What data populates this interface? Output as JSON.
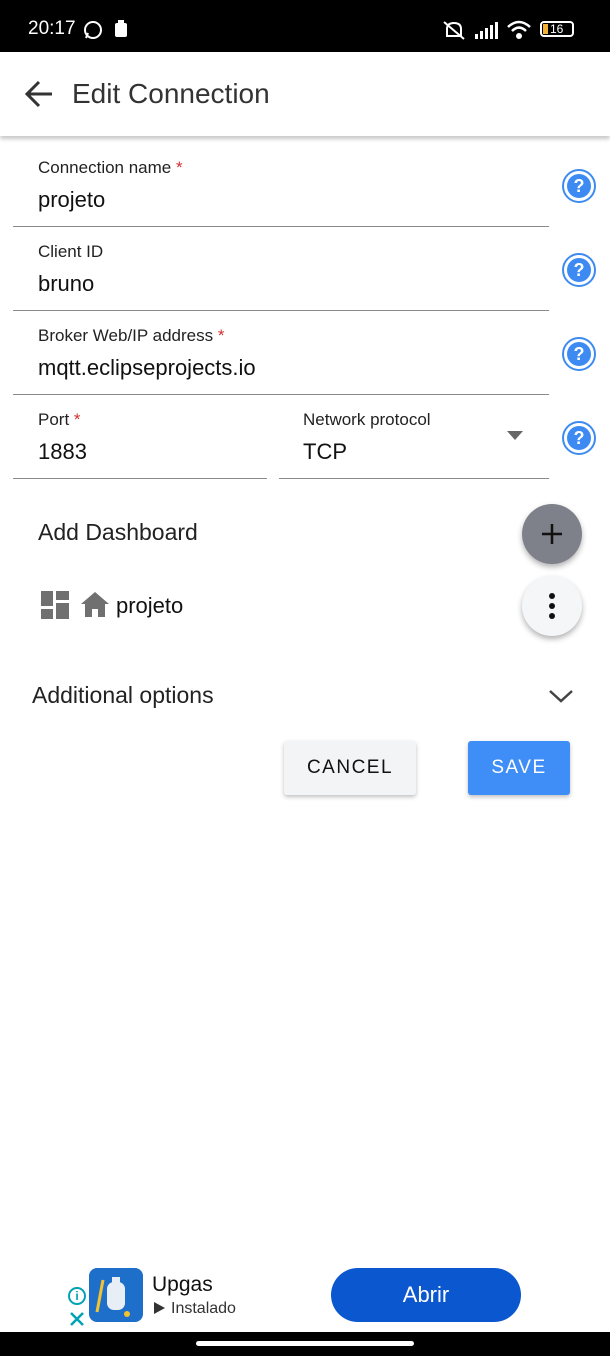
{
  "status_bar": {
    "time": "20:17",
    "battery": "16"
  },
  "app_bar": {
    "title": "Edit Connection"
  },
  "form": {
    "connection_name": {
      "label": "Connection name",
      "required_mark": "*",
      "value": "projeto"
    },
    "client_id": {
      "label": "Client ID",
      "value": "bruno"
    },
    "broker": {
      "label": "Broker Web/IP address",
      "required_mark": "*",
      "value": "mqtt.eclipseprojects.io"
    },
    "port": {
      "label": "Port",
      "required_mark": "*",
      "value": "1883"
    },
    "protocol": {
      "label": "Network protocol",
      "value": "TCP"
    }
  },
  "dashboard": {
    "heading": "Add Dashboard",
    "item_name": "projeto"
  },
  "additional": {
    "label": "Additional options"
  },
  "actions": {
    "cancel": "CANCEL",
    "save": "SAVE"
  },
  "ad": {
    "app_name": "Upgas",
    "status": "Instalado",
    "button": "Abrir"
  },
  "colors": {
    "accent": "#3d8bf2",
    "save_button": "#3f8ef7",
    "ad_button": "#0b57d0",
    "required": "#d32f2f"
  }
}
